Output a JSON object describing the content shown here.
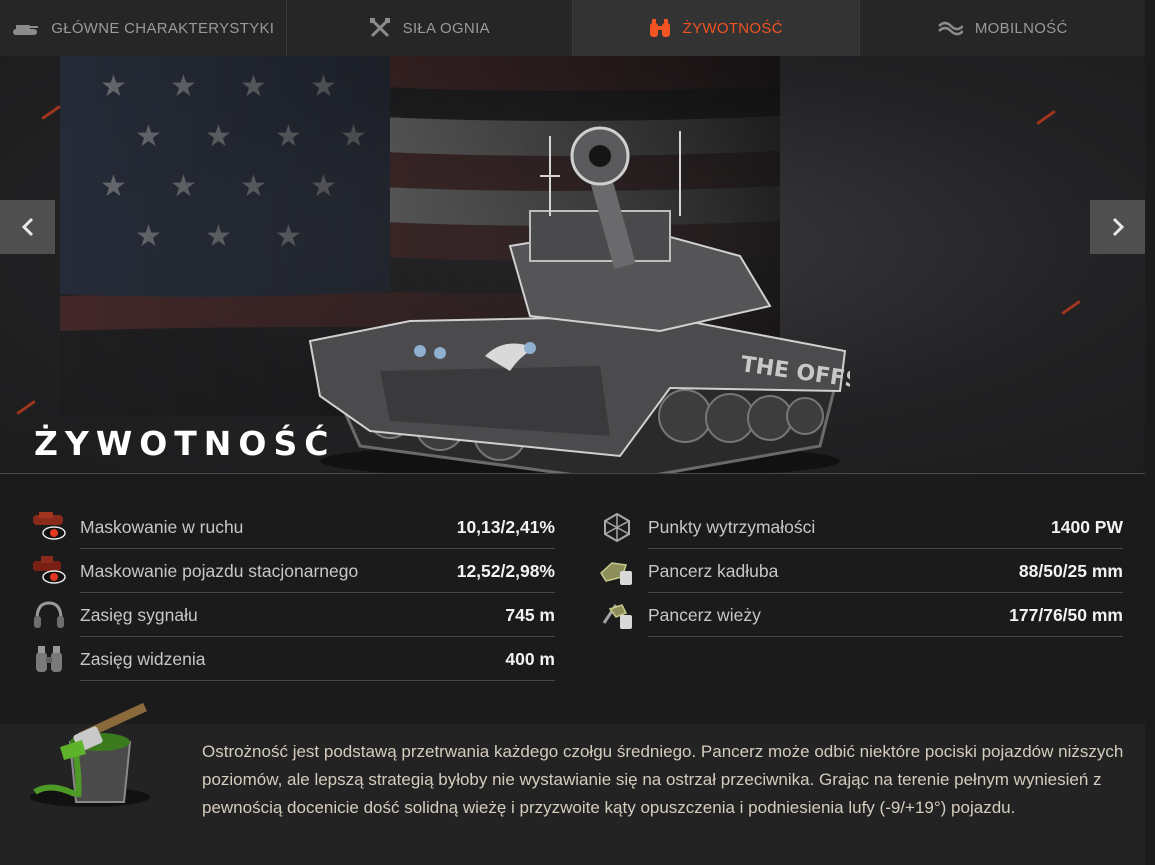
{
  "tabs": [
    {
      "label": "GŁÓWNE CHARAKTERYSTYKI",
      "icon": "tank-icon",
      "active": false
    },
    {
      "label": "SIŁA OGNIA",
      "icon": "crossed-guns-icon",
      "active": false
    },
    {
      "label": "ŻYWOTNOŚĆ",
      "icon": "binoculars-icon",
      "active": true
    },
    {
      "label": "MOBILNOŚĆ",
      "icon": "tracks-icon",
      "active": false
    }
  ],
  "hero": {
    "title": "ŻYWOTNOŚĆ",
    "tank_decal": "THE OFFSPRING"
  },
  "stats_left": [
    {
      "label": "Maskowanie w ruchu",
      "value": "10,13/2,41%",
      "icon": "camo-moving-icon"
    },
    {
      "label": "Maskowanie pojazdu stacjonarnego",
      "value": "12,52/2,98%",
      "icon": "camo-stationary-icon"
    },
    {
      "label": "Zasięg sygnału",
      "value": "745 m",
      "icon": "headphones-icon"
    },
    {
      "label": "Zasięg widzenia",
      "value": "400 m",
      "icon": "binoculars-icon"
    }
  ],
  "stats_right": [
    {
      "label": "Punkty wytrzymałości",
      "value": "1400 PW",
      "icon": "hit-points-icon"
    },
    {
      "label": "Pancerz kadłuba",
      "value": "88/50/25 mm",
      "icon": "hull-armor-icon"
    },
    {
      "label": "Pancerz wieży",
      "value": "177/76/50 mm",
      "icon": "turret-armor-icon"
    }
  ],
  "description": "Ostrożność jest podstawą przetrwania każdego czołgu średniego. Pancerz może odbić niektóre pociski pojazdów niższych poziomów, ale lepszą strategią byłoby nie wystawianie się na ostrzał przeciwnika. Grając na terenie pełnym wyniesień z pewnością docenicie dość solidną wieżę i przyzwoite kąty opuszczenia i podniesienia lufy (-9/+19°) pojazdu.",
  "colors": {
    "accent": "#f25322",
    "background": "#1b1b1c",
    "tab_bar": "#262627"
  }
}
